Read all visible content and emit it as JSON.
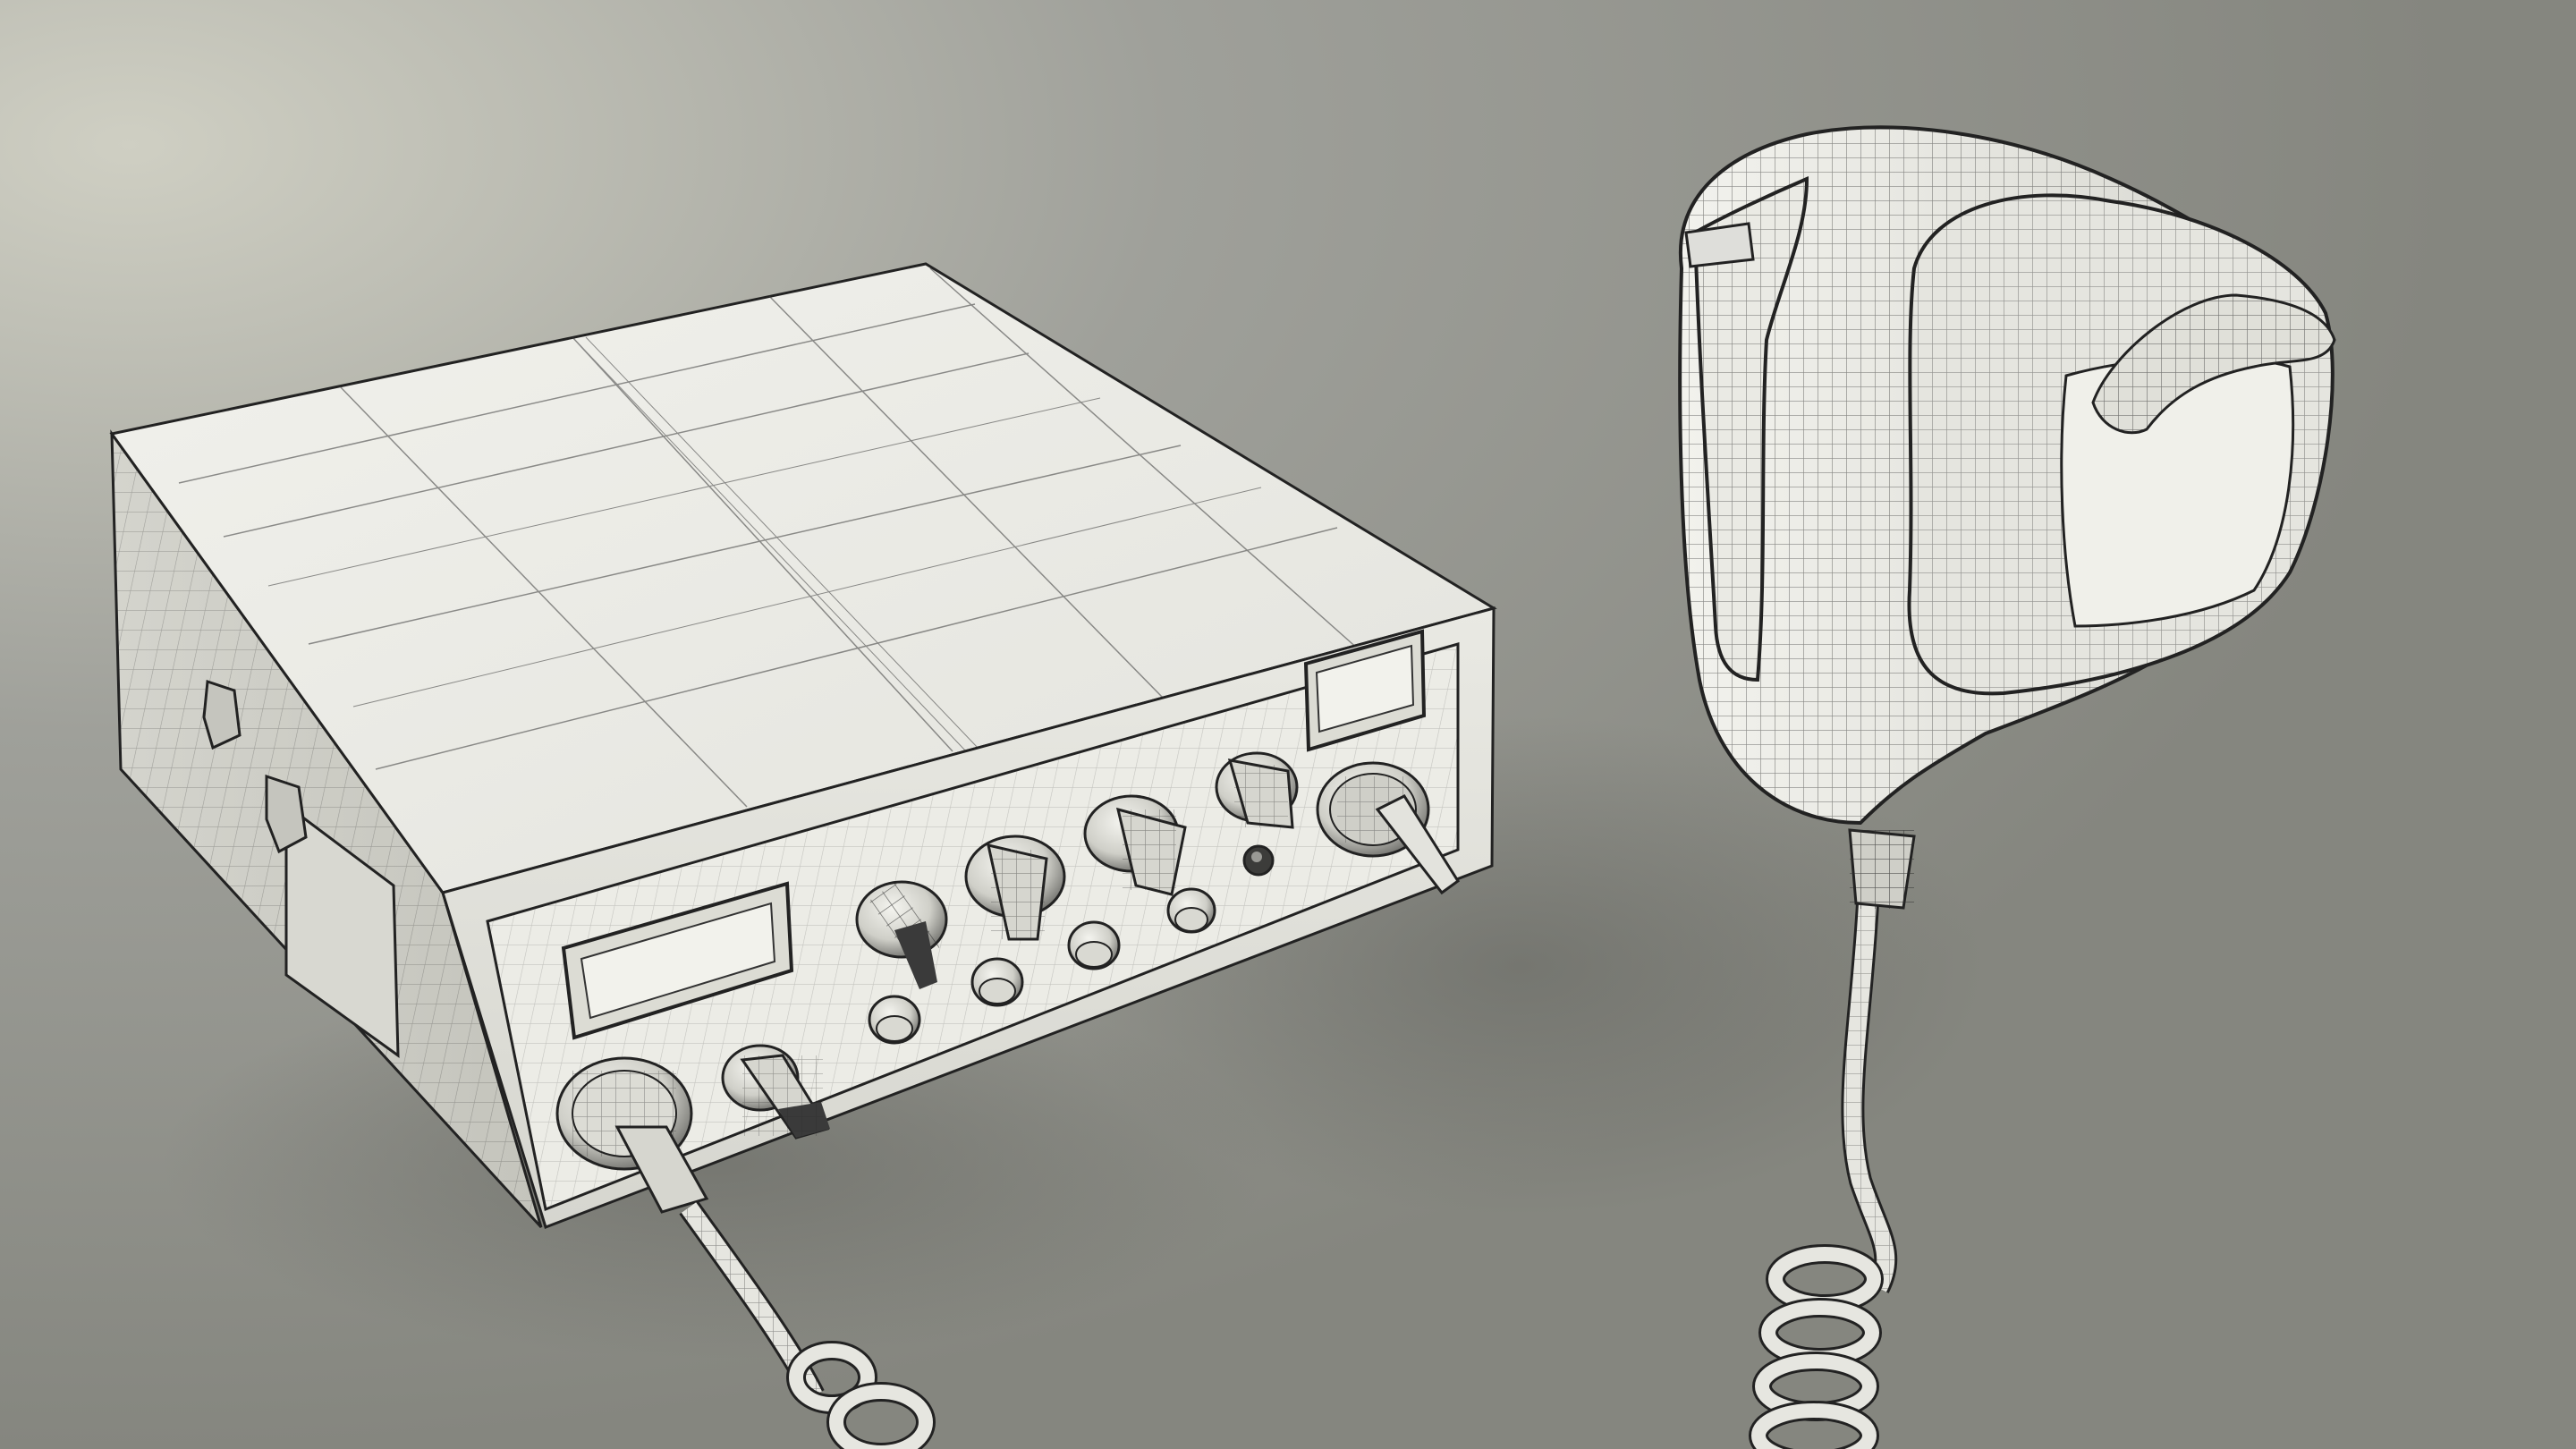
{
  "scene": {
    "kind": "wireframe-render",
    "subjects": [
      "cb-radio-transceiver",
      "handheld-microphone"
    ],
    "colors": {
      "background_light": "#c9c9bd",
      "background_mid": "#9a9b94",
      "background_dark": "#84857f",
      "model_surface": "#ecece6",
      "model_shade": "#c9c9c2",
      "wire": "#2a2a2a",
      "knob_dark": "#3a3a3a"
    }
  },
  "radio": {
    "front_knob_count": 6,
    "small_knob_count": 5,
    "displays": 2
  },
  "microphone": {
    "cable": "coiled"
  }
}
